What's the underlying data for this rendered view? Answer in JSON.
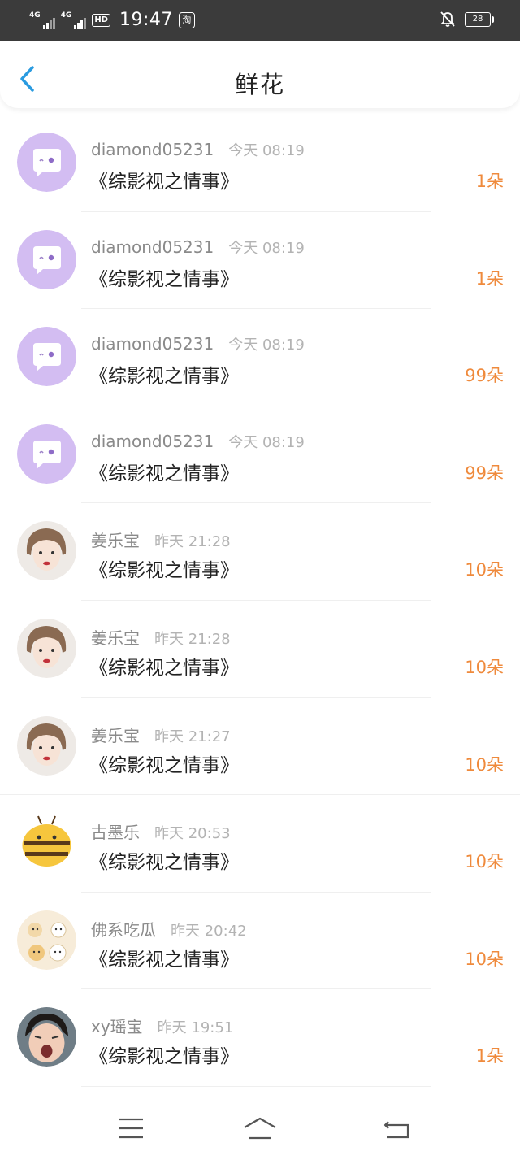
{
  "status_bar": {
    "signal1": "4G",
    "signal2": "4G",
    "hd": "HD",
    "time": "19:47",
    "app_badge": "淘",
    "battery": "28"
  },
  "header": {
    "title": "鲜花"
  },
  "flower_list": [
    {
      "avatar": "chat-bubble-default",
      "name": "diamond05231",
      "time": "今天 08:19",
      "work": "《综影视之情事》",
      "count": "1朵"
    },
    {
      "avatar": "chat-bubble-default",
      "name": "diamond05231",
      "time": "今天 08:19",
      "work": "《综影视之情事》",
      "count": "1朵"
    },
    {
      "avatar": "chat-bubble-default",
      "name": "diamond05231",
      "time": "今天 08:19",
      "work": "《综影视之情事》",
      "count": "99朵"
    },
    {
      "avatar": "chat-bubble-default",
      "name": "diamond05231",
      "time": "今天 08:19",
      "work": "《综影视之情事》",
      "count": "99朵"
    },
    {
      "avatar": "woman-photo",
      "name": "姜乐宝",
      "time": "昨天 21:28",
      "work": "《综影视之情事》",
      "count": "10朵"
    },
    {
      "avatar": "woman-photo",
      "name": "姜乐宝",
      "time": "昨天 21:28",
      "work": "《综影视之情事》",
      "count": "10朵"
    },
    {
      "avatar": "woman-photo",
      "name": "姜乐宝",
      "time": "昨天 21:27",
      "work": "《综影视之情事》",
      "count": "10朵"
    },
    {
      "avatar": "cartoon-bee",
      "name": "古墨乐",
      "time": "昨天 20:53",
      "work": "《综影视之情事》",
      "count": "10朵"
    },
    {
      "avatar": "cartoon-cats",
      "name": "佛系吃瓜",
      "time": "昨天 20:42",
      "work": "《综影视之情事》",
      "count": "10朵"
    },
    {
      "avatar": "child-photo",
      "name": "xy瑶宝",
      "time": "昨天 19:51",
      "work": "《综影视之情事》",
      "count": "1朵"
    }
  ],
  "colors": {
    "accent": "#2a9be0",
    "count": "#ef8a3c",
    "default_avatar": "#d3bdf2"
  },
  "navbar": {
    "icons": [
      "menu-icon",
      "home-icon",
      "back-icon"
    ]
  }
}
